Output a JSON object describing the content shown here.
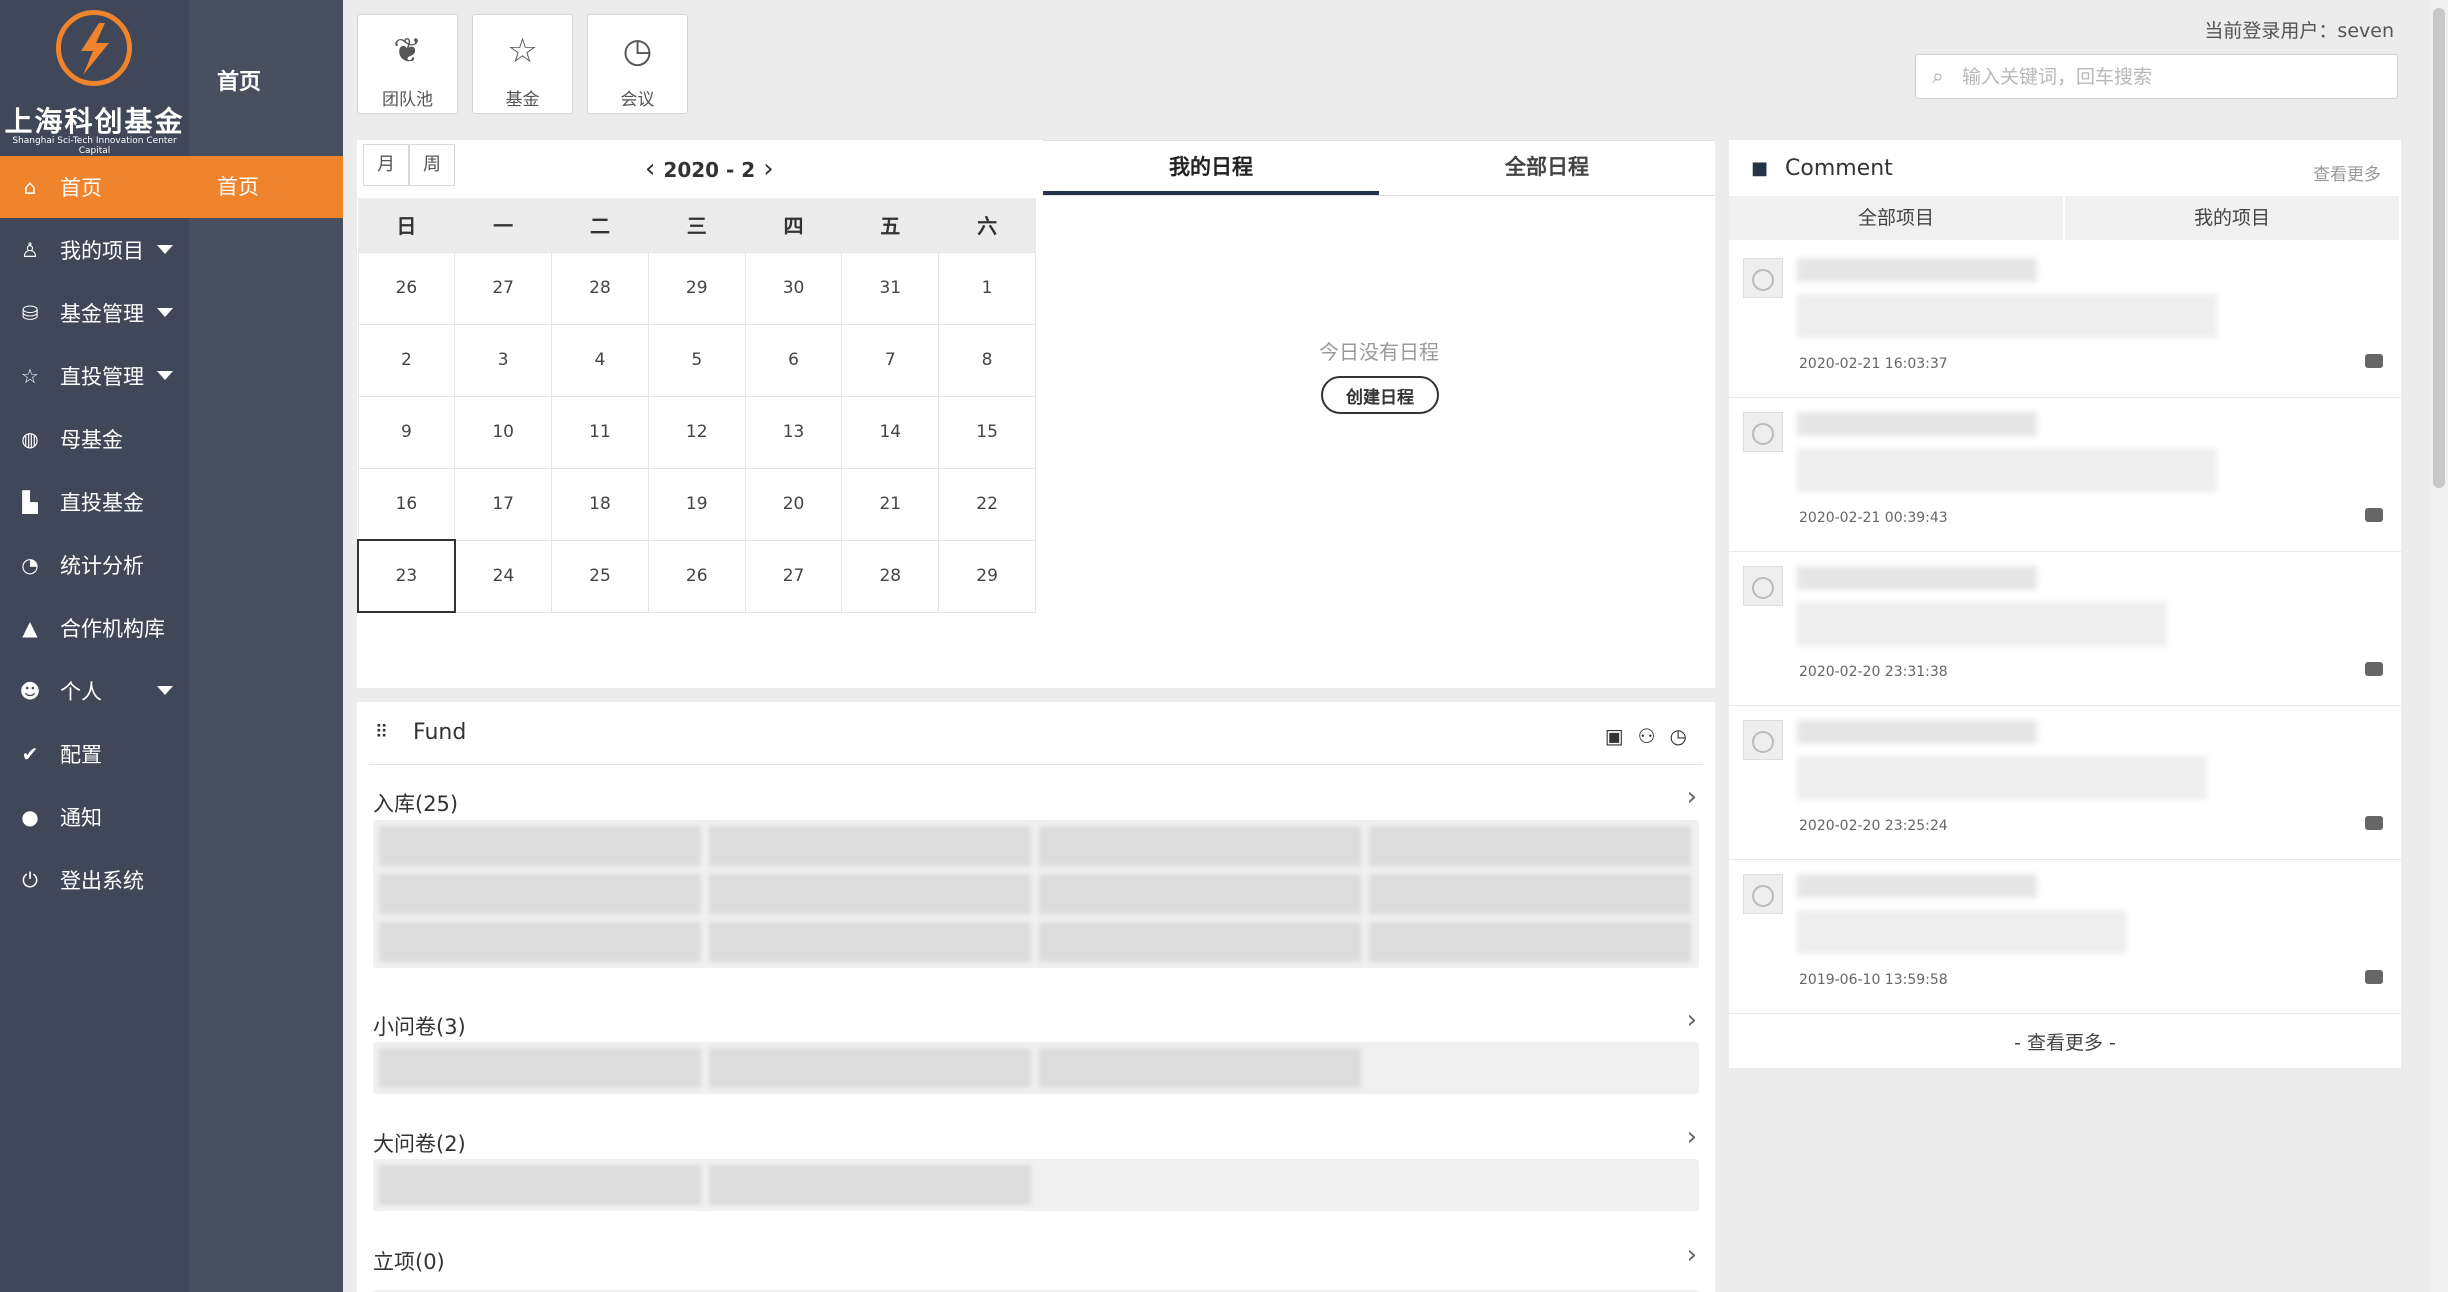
{
  "brand": {
    "cn": "上海科创基金",
    "en": "Shanghai Sci-Tech Innovation Center Capital"
  },
  "sidebar": {
    "items": [
      {
        "label": "首页",
        "icon": "home-icon",
        "glyph": "⌂",
        "caret": false,
        "active": true
      },
      {
        "label": "我的项目",
        "icon": "user-icon",
        "glyph": "♙",
        "caret": true,
        "active": false
      },
      {
        "label": "基金管理",
        "icon": "database-icon",
        "glyph": "⛁",
        "caret": true,
        "active": false
      },
      {
        "label": "直投管理",
        "icon": "star-icon",
        "glyph": "☆",
        "caret": true,
        "active": false
      },
      {
        "label": "母基金",
        "icon": "globe-icon",
        "glyph": "◍",
        "caret": false,
        "active": false
      },
      {
        "label": "直投基金",
        "icon": "bar-chart-icon",
        "glyph": "▙",
        "caret": false,
        "active": false
      },
      {
        "label": "统计分析",
        "icon": "pie-chart-icon",
        "glyph": "◔",
        "caret": false,
        "active": false
      },
      {
        "label": "合作机构库",
        "icon": "road-icon",
        "glyph": "▲",
        "caret": false,
        "active": false
      },
      {
        "label": "个人",
        "icon": "person-icon",
        "glyph": "☻",
        "caret": true,
        "active": false
      },
      {
        "label": "配置",
        "icon": "check-icon",
        "glyph": "✔",
        "caret": false,
        "active": false
      },
      {
        "label": "通知",
        "icon": "chat-bubble-icon",
        "glyph": "●",
        "caret": false,
        "active": false
      },
      {
        "label": "登出系统",
        "icon": "power-icon",
        "glyph": "⏻",
        "caret": false,
        "active": false
      }
    ]
  },
  "subnav": {
    "title": "首页",
    "item": "首页"
  },
  "quick": [
    {
      "label": "团队池",
      "icon": "leaf-icon",
      "glyph": "❦"
    },
    {
      "label": "基金",
      "icon": "star-outline-icon",
      "glyph": "☆"
    },
    {
      "label": "会议",
      "icon": "clock-icon",
      "glyph": "◷"
    }
  ],
  "header": {
    "login_user": "当前登录用户：seven",
    "search_placeholder": "输入关键词，回车搜索"
  },
  "calendar": {
    "view_month": "月",
    "view_week": "周",
    "title": "2020 - 2",
    "prev": "‹",
    "next": "›",
    "weekdays": [
      "日",
      "一",
      "二",
      "三",
      "四",
      "五",
      "六"
    ],
    "weeks": [
      [
        "26",
        "27",
        "28",
        "29",
        "30",
        "31",
        "1"
      ],
      [
        "2",
        "3",
        "4",
        "5",
        "6",
        "7",
        "8"
      ],
      [
        "9",
        "10",
        "11",
        "12",
        "13",
        "14",
        "15"
      ],
      [
        "16",
        "17",
        "18",
        "19",
        "20",
        "21",
        "22"
      ],
      [
        "23",
        "24",
        "25",
        "26",
        "27",
        "28",
        "29"
      ]
    ],
    "today": "23"
  },
  "schedule": {
    "tab_mine": "我的日程",
    "tab_all": "全部日程",
    "empty": "今日没有日程",
    "create": "创建日程"
  },
  "fund": {
    "title": "Fund",
    "sections": [
      {
        "label": "入库(25)",
        "chips": 12
      },
      {
        "label": "小问卷(3)",
        "chips": 3
      },
      {
        "label": "大问卷(2)",
        "chips": 2
      },
      {
        "label": "立项(0)",
        "chips": 0
      }
    ]
  },
  "comment": {
    "title": "Comment",
    "more_top": "查看更多",
    "tab_all": "全部项目",
    "tab_mine": "我的项目",
    "items": [
      {
        "time": "2020-02-21 16:03:37"
      },
      {
        "time": "2020-02-21 00:39:43"
      },
      {
        "time": "2020-02-20 23:31:38"
      },
      {
        "time": "2020-02-20 23:25:24"
      },
      {
        "time": "2019-06-10 13:59:58"
      }
    ],
    "more_bottom": "- 查看更多 -"
  },
  "colors": {
    "accent": "#f0842c",
    "sidebar": "#3f4758",
    "subnav": "#48505f",
    "tab_underline": "#24324a"
  }
}
